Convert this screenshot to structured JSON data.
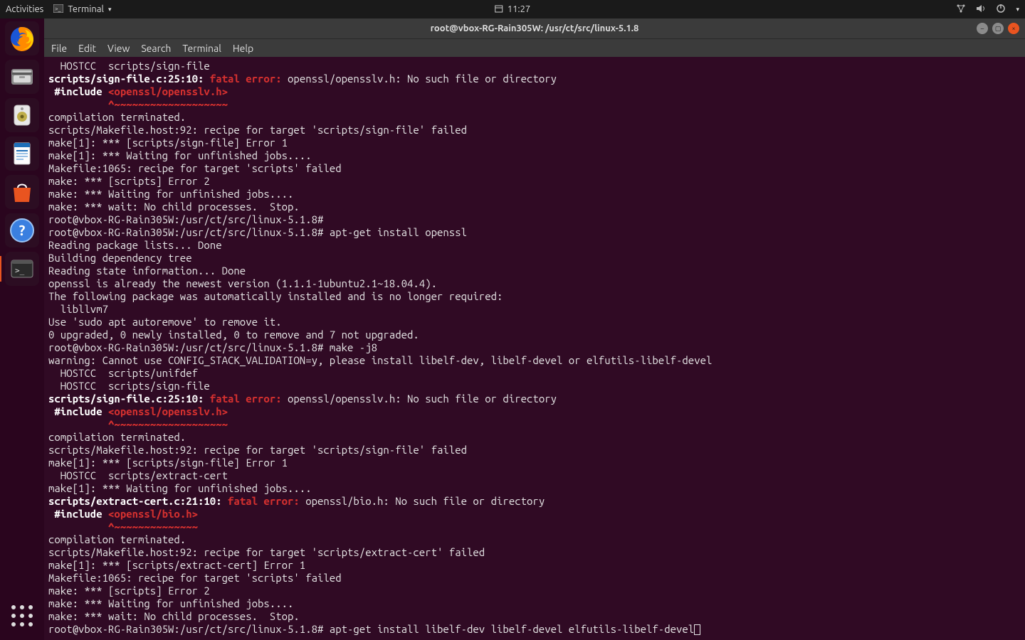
{
  "topbar": {
    "activities": "Activities",
    "app_label": "Terminal",
    "clock": "11:27"
  },
  "launcher": {
    "items": [
      {
        "name": "firefox"
      },
      {
        "name": "files"
      },
      {
        "name": "rhythmbox"
      },
      {
        "name": "writer"
      },
      {
        "name": "software"
      },
      {
        "name": "help"
      },
      {
        "name": "terminal"
      }
    ]
  },
  "window": {
    "title": "root@vbox-RG-Rain305W: /usr/ct/src/linux-5.1.8",
    "menu": [
      "File",
      "Edit",
      "View",
      "Search",
      "Terminal",
      "Help"
    ]
  },
  "term": {
    "lines": [
      {
        "segs": [
          {
            "t": "  HOSTCC  scripts/sign-file"
          }
        ]
      },
      {
        "segs": [
          {
            "t": "scripts/sign-file.c:25:10:",
            "c": "bold"
          },
          {
            "t": " "
          },
          {
            "t": "fatal error:",
            "c": "redb"
          },
          {
            "t": " openssl/opensslv.h: No such file or directory"
          }
        ]
      },
      {
        "segs": [
          {
            "t": " #include ",
            "c": "bold"
          },
          {
            "t": "<openssl/opensslv.h>",
            "c": "redb"
          }
        ]
      },
      {
        "segs": [
          {
            "t": "          ",
            "c": ""
          },
          {
            "t": "^~~~~~~~~~~~~~~~~~~~",
            "c": "redb"
          }
        ]
      },
      {
        "segs": [
          {
            "t": "compilation terminated."
          }
        ]
      },
      {
        "segs": [
          {
            "t": "scripts/Makefile.host:92: recipe for target 'scripts/sign-file' failed"
          }
        ]
      },
      {
        "segs": [
          {
            "t": "make[1]: *** [scripts/sign-file] Error 1"
          }
        ]
      },
      {
        "segs": [
          {
            "t": "make[1]: *** Waiting for unfinished jobs...."
          }
        ]
      },
      {
        "segs": [
          {
            "t": "Makefile:1065: recipe for target 'scripts' failed"
          }
        ]
      },
      {
        "segs": [
          {
            "t": "make: *** [scripts] Error 2"
          }
        ]
      },
      {
        "segs": [
          {
            "t": "make: *** Waiting for unfinished jobs...."
          }
        ]
      },
      {
        "segs": [
          {
            "t": "make: *** wait: No child processes.  Stop."
          }
        ]
      },
      {
        "segs": [
          {
            "t": "root@vbox-RG-Rain305W:/usr/ct/src/linux-5.1.8#"
          }
        ]
      },
      {
        "segs": [
          {
            "t": "root@vbox-RG-Rain305W:/usr/ct/src/linux-5.1.8# apt-get install openssl"
          }
        ]
      },
      {
        "segs": [
          {
            "t": "Reading package lists... Done"
          }
        ]
      },
      {
        "segs": [
          {
            "t": "Building dependency tree"
          }
        ]
      },
      {
        "segs": [
          {
            "t": "Reading state information... Done"
          }
        ]
      },
      {
        "segs": [
          {
            "t": "openssl is already the newest version (1.1.1-1ubuntu2.1~18.04.4)."
          }
        ]
      },
      {
        "segs": [
          {
            "t": "The following package was automatically installed and is no longer required:"
          }
        ]
      },
      {
        "segs": [
          {
            "t": "  libllvm7"
          }
        ]
      },
      {
        "segs": [
          {
            "t": "Use 'sudo apt autoremove' to remove it."
          }
        ]
      },
      {
        "segs": [
          {
            "t": "0 upgraded, 0 newly installed, 0 to remove and 7 not upgraded."
          }
        ]
      },
      {
        "segs": [
          {
            "t": "root@vbox-RG-Rain305W:/usr/ct/src/linux-5.1.8# make -j8"
          }
        ]
      },
      {
        "segs": [
          {
            "t": "warning: Cannot use CONFIG_STACK_VALIDATION=y, please install libelf-dev, libelf-devel or elfutils-libelf-devel"
          }
        ]
      },
      {
        "segs": [
          {
            "t": "  HOSTCC  scripts/unifdef"
          }
        ]
      },
      {
        "segs": [
          {
            "t": "  HOSTCC  scripts/sign-file"
          }
        ]
      },
      {
        "segs": [
          {
            "t": "scripts/sign-file.c:25:10:",
            "c": "bold"
          },
          {
            "t": " "
          },
          {
            "t": "fatal error:",
            "c": "redb"
          },
          {
            "t": " openssl/opensslv.h: No such file or directory"
          }
        ]
      },
      {
        "segs": [
          {
            "t": " #include ",
            "c": "bold"
          },
          {
            "t": "<openssl/opensslv.h>",
            "c": "redb"
          }
        ]
      },
      {
        "segs": [
          {
            "t": "          "
          },
          {
            "t": "^~~~~~~~~~~~~~~~~~~~",
            "c": "redb"
          }
        ]
      },
      {
        "segs": [
          {
            "t": "compilation terminated."
          }
        ]
      },
      {
        "segs": [
          {
            "t": "scripts/Makefile.host:92: recipe for target 'scripts/sign-file' failed"
          }
        ]
      },
      {
        "segs": [
          {
            "t": "make[1]: *** [scripts/sign-file] Error 1"
          }
        ]
      },
      {
        "segs": [
          {
            "t": "  HOSTCC  scripts/extract-cert"
          }
        ]
      },
      {
        "segs": [
          {
            "t": "make[1]: *** Waiting for unfinished jobs...."
          }
        ]
      },
      {
        "segs": [
          {
            "t": "scripts/extract-cert.c:21:10:",
            "c": "bold"
          },
          {
            "t": " "
          },
          {
            "t": "fatal error:",
            "c": "redb"
          },
          {
            "t": " openssl/bio.h: No such file or directory"
          }
        ]
      },
      {
        "segs": [
          {
            "t": " #include ",
            "c": "bold"
          },
          {
            "t": "<openssl/bio.h>",
            "c": "redb"
          }
        ]
      },
      {
        "segs": [
          {
            "t": "          "
          },
          {
            "t": "^~~~~~~~~~~~~~~",
            "c": "redb"
          }
        ]
      },
      {
        "segs": [
          {
            "t": "compilation terminated."
          }
        ]
      },
      {
        "segs": [
          {
            "t": "scripts/Makefile.host:92: recipe for target 'scripts/extract-cert' failed"
          }
        ]
      },
      {
        "segs": [
          {
            "t": "make[1]: *** [scripts/extract-cert] Error 1"
          }
        ]
      },
      {
        "segs": [
          {
            "t": "Makefile:1065: recipe for target 'scripts' failed"
          }
        ]
      },
      {
        "segs": [
          {
            "t": "make: *** [scripts] Error 2"
          }
        ]
      },
      {
        "segs": [
          {
            "t": "make: *** Waiting for unfinished jobs...."
          }
        ]
      },
      {
        "segs": [
          {
            "t": "make: *** wait: No child processes.  Stop."
          }
        ]
      },
      {
        "segs": [
          {
            "t": "root@vbox-RG-Rain305W:/usr/ct/src/linux-5.1.8# apt-get install libelf-dev libelf-devel elfutils-libelf-devel"
          }
        ],
        "cursor": true
      }
    ]
  }
}
